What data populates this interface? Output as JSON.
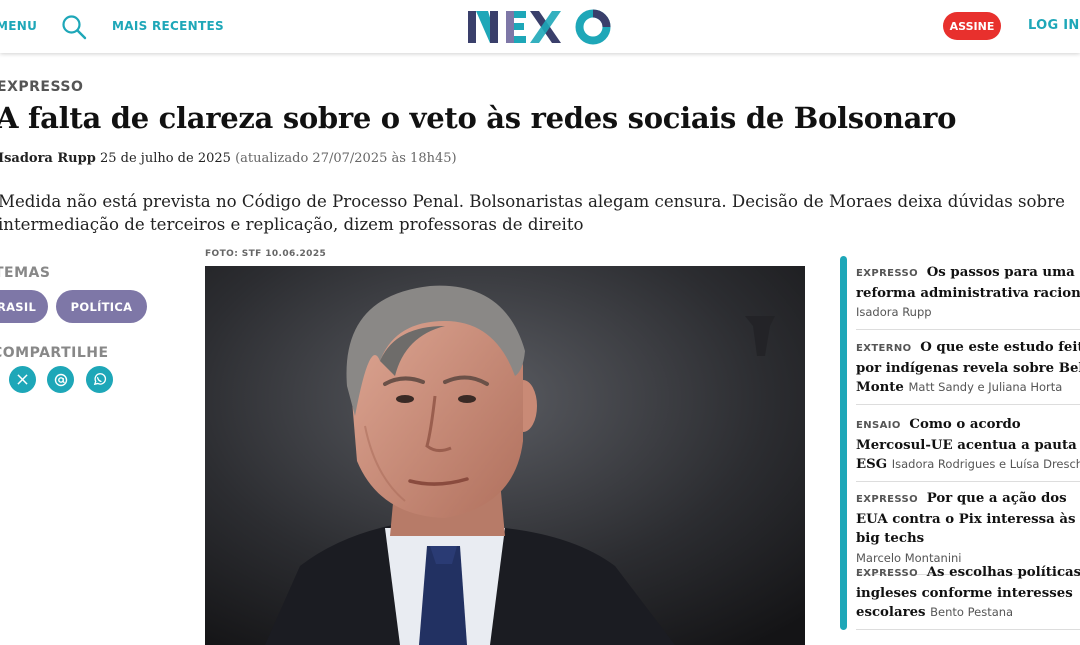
{
  "header": {
    "menu_label": "MENU",
    "search_icon": "search-icon",
    "recent_label": "MAIS RECENTES",
    "logo_text": "NEXO",
    "subscribe_label": "ASSINE",
    "login_label": "LOG IN",
    "colors": {
      "accent": "#1ea7b8",
      "subscribe": "#e8302d"
    }
  },
  "article": {
    "kicker": "EXPRESSO",
    "title": "A falta de clareza sobre o veto às redes sociais de Bolsonaro",
    "author": "Isadora Rupp",
    "date": "25 de julho de 2025",
    "updated": "(atualizado 27/07/2025 às 18h45)",
    "lede": "Medida não está prevista no Código de Processo Penal. Bolsonaristas alegam censura. Decisão de Moraes deixa dúvidas sobre intermediação de terceiros e replicação, dizem professoras de direito",
    "photo_credit": "FOTO: STF 10.06.2025"
  },
  "sidebar_left": {
    "temas_label": "TEMAS",
    "tags": [
      "BRASIL",
      "POLÍTICA"
    ],
    "tag_color": "#7e77a7",
    "share_label": "COMPARTILHE",
    "share_icons": [
      "x-icon",
      "email-icon",
      "whatsapp-icon"
    ]
  },
  "rail": {
    "items": [
      {
        "kicker": "EXPRESSO",
        "title": "Os passos para uma reforma administrativa racional",
        "author": "Isadora Rupp"
      },
      {
        "kicker": "EXTERNO",
        "title": "O que este estudo feito por indígenas revela sobre Belo Monte",
        "author": "Matt Sandy e Juliana Horta"
      },
      {
        "kicker": "ENSAIO",
        "title": "Como o acordo Mercosul-UE acentua a pauta ESG",
        "author": "Isadora Rodrigues e Luísa Dresch"
      },
      {
        "kicker": "EXPRESSO",
        "title": "Por que a ação dos EUA contra o Pix interessa às big techs",
        "author": "Marcelo Montanini"
      },
      {
        "kicker": "EXPRESSO",
        "title": "As escolhas políticas ingleses conforme interesses escolares",
        "author": "Bento Pestana"
      }
    ]
  }
}
